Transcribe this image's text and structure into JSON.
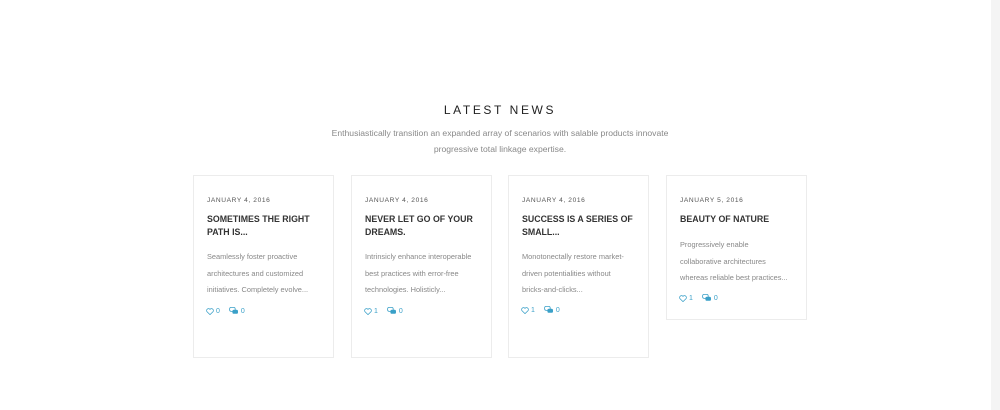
{
  "section": {
    "title": "LATEST NEWS",
    "subtitle_line1": "Enthusiastically transition an expanded array of scenarios with salable products innovate",
    "subtitle_line2": "progressive total linkage expertise."
  },
  "posts": [
    {
      "date": "JANUARY 4, 2016",
      "title_line1": "SOMETIMES THE RIGHT",
      "title_line2": "PATH IS...",
      "excerpt_line1": "Seamlessly foster proactive",
      "excerpt_line2": "architectures and customized",
      "excerpt_line3": "initiatives. Completely evolve...",
      "likes": "0",
      "comments": "0"
    },
    {
      "date": "JANUARY 4, 2016",
      "title_line1": "NEVER LET GO OF YOUR",
      "title_line2": "DREAMS.",
      "excerpt_line1": "Intrinsicly enhance interoperable",
      "excerpt_line2": "best practices with error-free",
      "excerpt_line3": "technologies. Holisticly...",
      "likes": "1",
      "comments": "0"
    },
    {
      "date": "JANUARY 4, 2016",
      "title_line1": "SUCCESS IS A SERIES OF",
      "title_line2": "SMALL...",
      "excerpt_line1": "Monotonectally restore market-",
      "excerpt_line2": "driven potentialities without",
      "excerpt_line3": "bricks-and-clicks...",
      "likes": "1",
      "comments": "0"
    },
    {
      "date": "JANUARY 5, 2016",
      "title_line1": "BEAUTY OF NATURE",
      "title_line2": "",
      "excerpt_line1": "Progressively enable",
      "excerpt_line2": "collaborative architectures",
      "excerpt_line3": "whereas reliable best practices...",
      "likes": "1",
      "comments": "0"
    }
  ],
  "icons": {
    "like": "heart-icon",
    "comment": "comment-icon"
  },
  "colors": {
    "accent": "#3aa0c8",
    "text": "#333333",
    "muted": "#888888",
    "border": "#ececec"
  }
}
